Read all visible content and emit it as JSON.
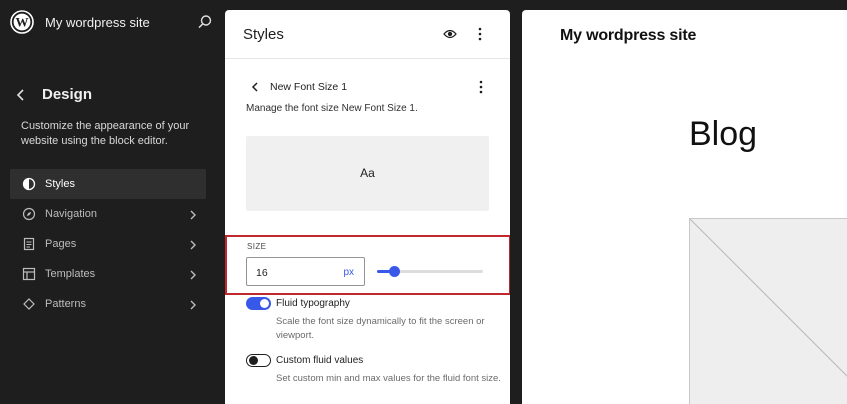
{
  "sidebar": {
    "site_title": "My wordpress site",
    "section_title": "Design",
    "description": "Customize the appearance of your website using the block editor.",
    "items": [
      {
        "label": "Styles",
        "icon": "half-circle-icon",
        "active": true
      },
      {
        "label": "Navigation",
        "icon": "compass-icon"
      },
      {
        "label": "Pages",
        "icon": "page-icon"
      },
      {
        "label": "Templates",
        "icon": "layout-icon"
      },
      {
        "label": "Patterns",
        "icon": "diamond-icon"
      }
    ]
  },
  "styles_panel": {
    "title": "Styles",
    "subpanel_title": "New Font Size 1",
    "subpanel_desc": "Manage the font size New Font Size 1.",
    "preview_text": "Aa",
    "size": {
      "label": "SIZE",
      "value": "16",
      "unit": "px",
      "slider_fraction": 0.16
    },
    "fluid": {
      "label": "Fluid typography",
      "help": "Scale the font size dynamically to fit the screen or viewport.",
      "on": true
    },
    "custom_fluid": {
      "label": "Custom fluid values",
      "help": "Set custom min and max values for the fluid font size.",
      "on": false
    }
  },
  "canvas": {
    "site_title": "My wordpress site",
    "heading": "Blog"
  },
  "colors": {
    "accent": "#3858e9",
    "highlight": "#c0282e",
    "sidebar_bg": "#1e1e1e"
  }
}
